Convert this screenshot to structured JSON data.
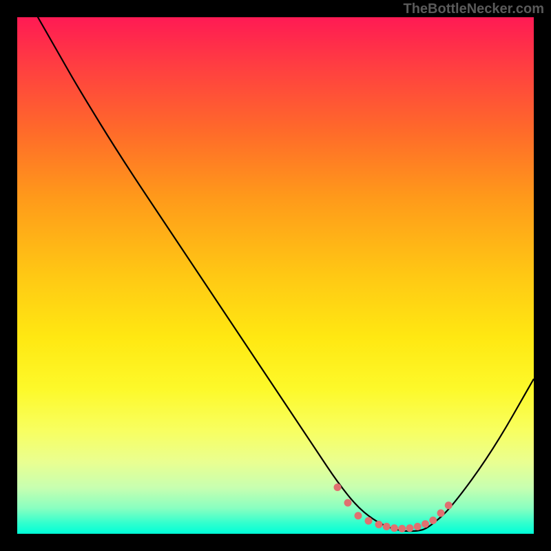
{
  "attribution": "TheBottleNecker.com",
  "chart_data": {
    "type": "line",
    "title": "",
    "xlabel": "",
    "ylabel": "",
    "xlim": [
      0,
      100
    ],
    "ylim": [
      0,
      100
    ],
    "series": [
      {
        "name": "bottleneck-curve",
        "x": [
          0,
          4,
          8,
          12,
          20,
          30,
          40,
          50,
          58,
          62,
          66,
          70,
          74,
          78,
          80,
          84,
          92,
          100
        ],
        "y": [
          107,
          100,
          93,
          86,
          73,
          58,
          43,
          28,
          16,
          10,
          5,
          2,
          0.5,
          0.5,
          1.5,
          5,
          16,
          30
        ]
      }
    ],
    "markers": {
      "name": "highlight-dots",
      "color": "#e07070",
      "points": [
        {
          "x": 62,
          "y": 9
        },
        {
          "x": 64,
          "y": 6
        },
        {
          "x": 66,
          "y": 3.5
        },
        {
          "x": 68,
          "y": 2.5
        },
        {
          "x": 70,
          "y": 1.8
        },
        {
          "x": 71.5,
          "y": 1.4
        },
        {
          "x": 73,
          "y": 1.1
        },
        {
          "x": 74.5,
          "y": 1.0
        },
        {
          "x": 76,
          "y": 1.1
        },
        {
          "x": 77.5,
          "y": 1.4
        },
        {
          "x": 79,
          "y": 1.9
        },
        {
          "x": 80.5,
          "y": 2.6
        },
        {
          "x": 82,
          "y": 4.0
        },
        {
          "x": 83.5,
          "y": 5.5
        }
      ]
    }
  }
}
